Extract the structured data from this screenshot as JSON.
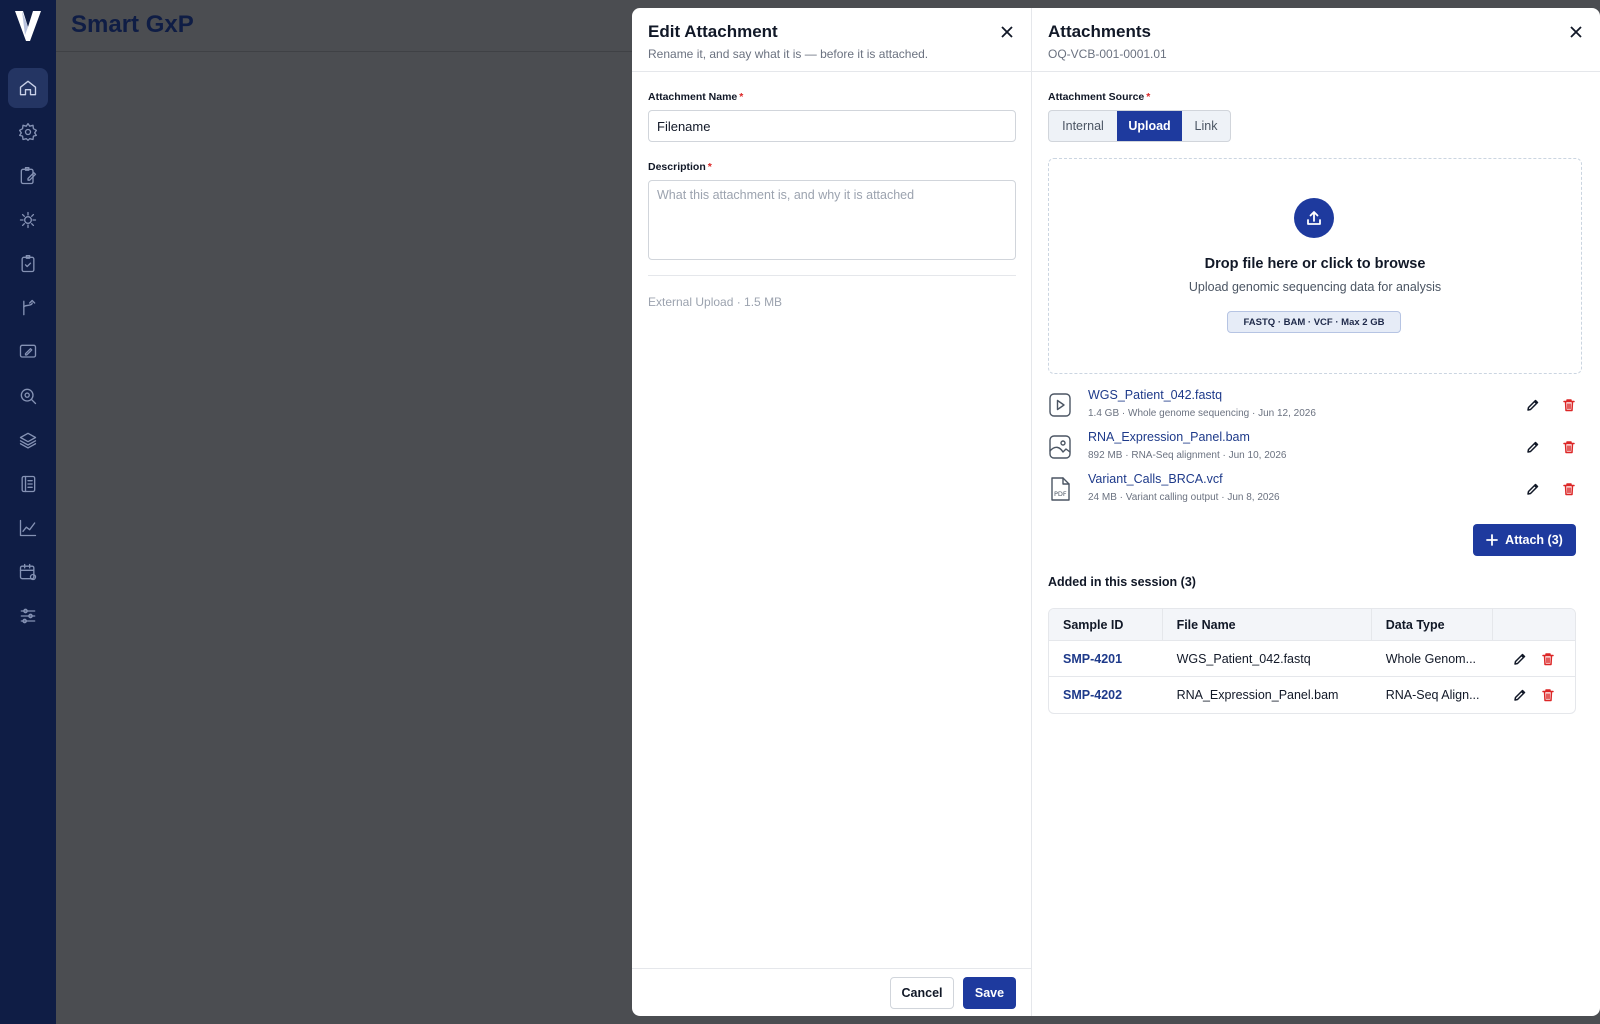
{
  "app": {
    "title": "Smart GxP"
  },
  "sidebar": {
    "items": [
      {
        "name": "home-icon",
        "active": true
      },
      {
        "name": "gear-icon"
      },
      {
        "name": "clipboard-edit-icon"
      },
      {
        "name": "settings-cog-icon"
      },
      {
        "name": "clipboard-check-icon"
      },
      {
        "name": "branch-icon"
      },
      {
        "name": "message-edit-icon"
      },
      {
        "name": "search-settings-icon"
      },
      {
        "name": "layers-icon"
      },
      {
        "name": "notebook-icon"
      },
      {
        "name": "line-chart-icon"
      },
      {
        "name": "calendar-settings-icon"
      },
      {
        "name": "sliders-icon"
      }
    ]
  },
  "edit_attachment": {
    "title": "Edit Attachment",
    "subtitle": "Rename it, and say what it is — before it is attached.",
    "name_label": "Attachment Name",
    "name_value": "Filename",
    "description_label": "Description",
    "description_placeholder": "What this attachment is, and why it is attached",
    "required_mark": "*",
    "meta": "External Upload · 1.5 MB",
    "cancel_label": "Cancel",
    "save_label": "Save"
  },
  "attachments": {
    "title": "Attachments",
    "subtitle": "OQ-VCB-001-0001.01",
    "source_label": "Attachment Source",
    "required_mark": "*",
    "source_options": [
      "Internal",
      "Upload",
      "Link"
    ],
    "source_selected": "Upload",
    "dropzone": {
      "title": "Drop file here or click to browse",
      "subtitle": "Upload genomic sequencing data for analysis",
      "formats": "FASTQ · BAM · VCF · Max 2 GB"
    },
    "files": [
      {
        "name": "WGS_Patient_042.fastq",
        "meta": "1.4 GB · Whole genome sequencing · Jun 12, 2026",
        "icon": "file-video-icon"
      },
      {
        "name": "RNA_Expression_Panel.bam",
        "meta": "892 MB · RNA-Seq alignment · Jun 10, 2026",
        "icon": "file-image-icon"
      },
      {
        "name": "Variant_Calls_BRCA.vcf",
        "meta": "24 MB · Variant calling output · Jun 8, 2026",
        "icon": "file-pdf-icon"
      }
    ],
    "attach_label": "Attach (3)",
    "session_title": "Added in this session (3)",
    "table": {
      "columns": [
        "Sample ID",
        "File Name",
        "Data Type",
        ""
      ],
      "rows": [
        {
          "sample_id": "SMP-4201",
          "file_name": "WGS_Patient_042.fastq",
          "data_type": "Whole Genom..."
        },
        {
          "sample_id": "SMP-4202",
          "file_name": "RNA_Expression_Panel.bam",
          "data_type": "RNA-Seq Align..."
        }
      ]
    }
  },
  "colors": {
    "sidebar": "#0f1d45",
    "primary": "#1e3a9e",
    "danger": "#dc2626",
    "overlay": "#4b4d51"
  }
}
